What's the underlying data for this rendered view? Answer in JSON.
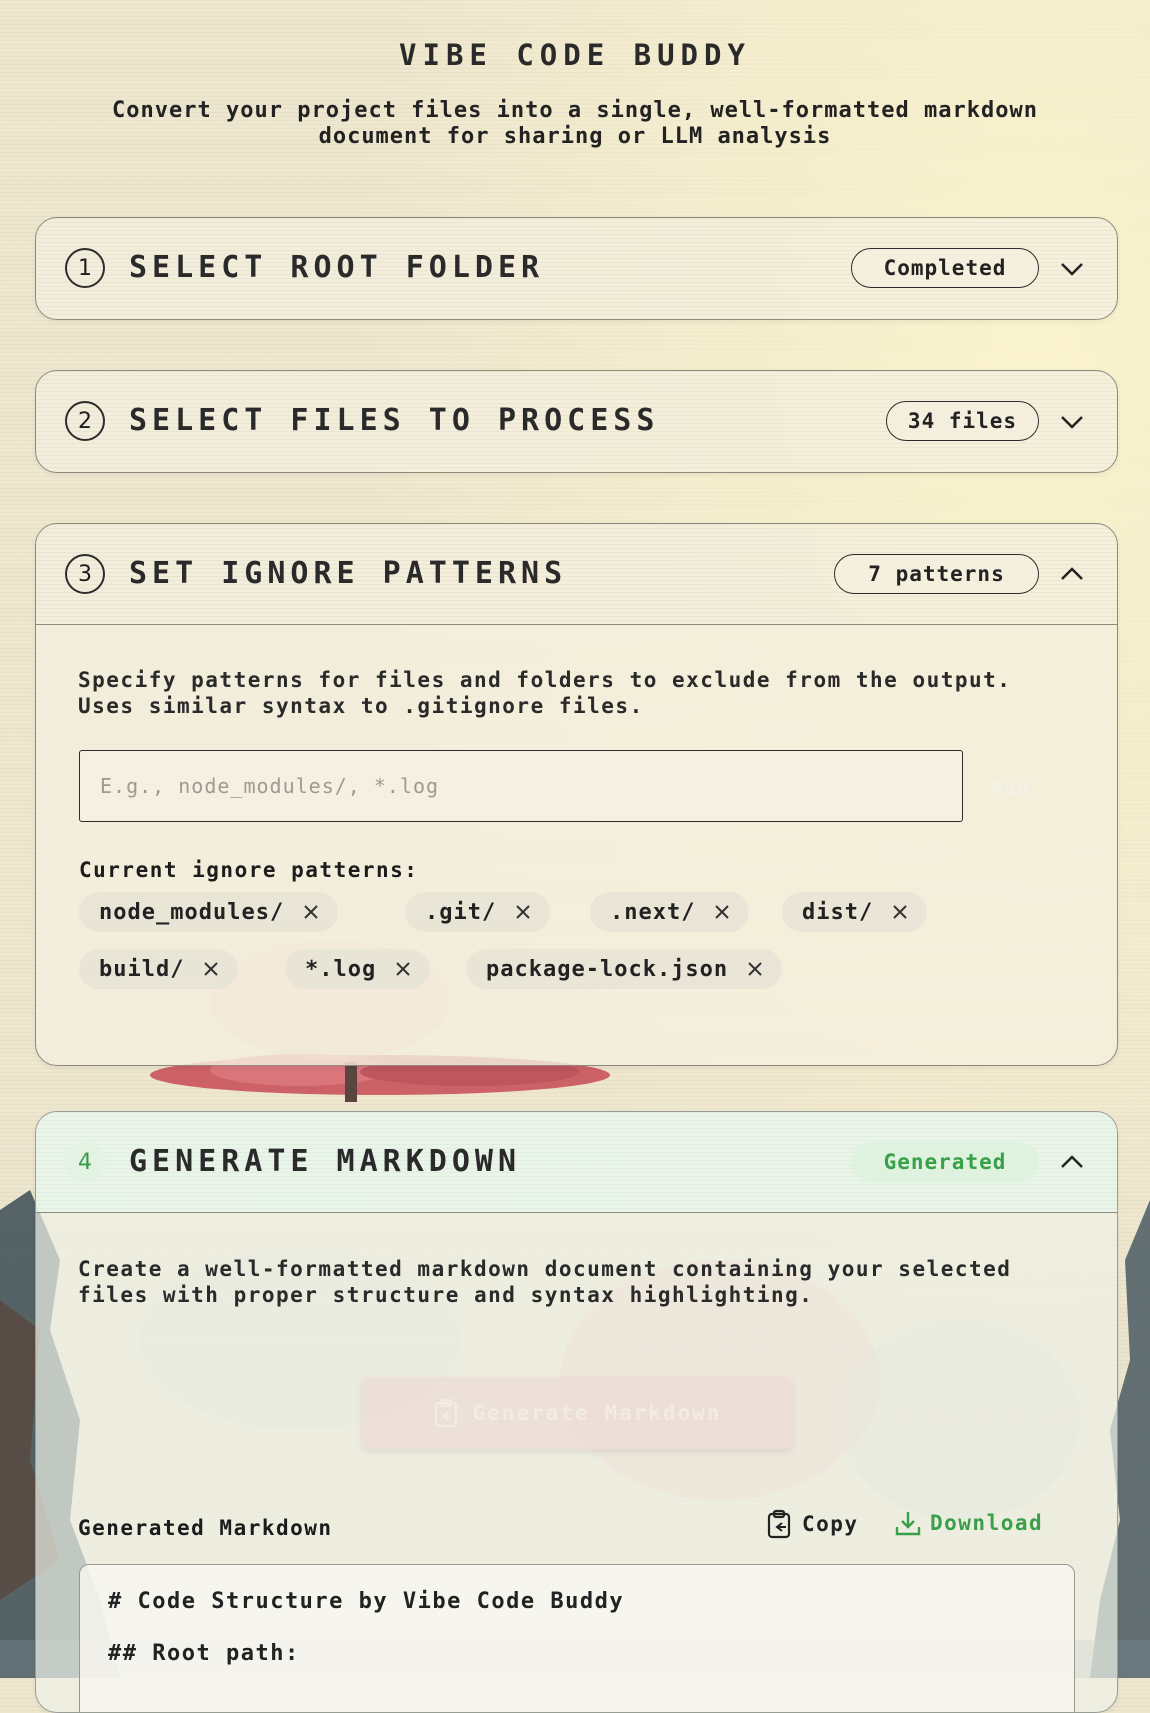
{
  "app": {
    "title": "VIBE CODE BUDDY",
    "subtitle": "Convert your project files into a single, well-formatted markdown document for sharing or LLM analysis"
  },
  "steps": [
    {
      "number": "1",
      "title": "SELECT ROOT FOLDER",
      "badge": "Completed",
      "state": "collapsed",
      "chevron": "chevron-down-icon"
    },
    {
      "number": "2",
      "title": "SELECT FILES TO PROCESS",
      "badge": "34 files",
      "state": "collapsed",
      "chevron": "chevron-down-icon"
    },
    {
      "number": "3",
      "title": "SET IGNORE PATTERNS",
      "badge": "7 patterns",
      "state": "expanded",
      "chevron": "chevron-up-icon",
      "description": "Specify patterns for files and folders to exclude from the output. Uses similar syntax to .gitignore files.",
      "input_placeholder": "E.g., node_modules/, *.log",
      "add_label": "Add",
      "current_label": "Current ignore patterns:",
      "patterns": [
        "node_modules/",
        ".git/",
        ".next/",
        "dist/",
        "build/",
        "*.log",
        "package-lock.json"
      ]
    },
    {
      "number": "4",
      "title": "GENERATE MARKDOWN",
      "badge": "Generated",
      "state": "expanded",
      "chevron": "chevron-up-icon",
      "description": "Create a well-formatted markdown document containing your selected files with proper structure and syntax highlighting.",
      "generate_label": "Generate Markdown",
      "output_label": "Generated Markdown",
      "copy_label": "Copy",
      "download_label": "Download",
      "markdown_lines": [
        "# Code Structure by Vibe Code Buddy",
        "## Root path:"
      ]
    }
  ],
  "colors": {
    "background": "#eee7cf",
    "accent_green": "#38a048",
    "border": "#8f8a7c",
    "text": "#222222"
  }
}
